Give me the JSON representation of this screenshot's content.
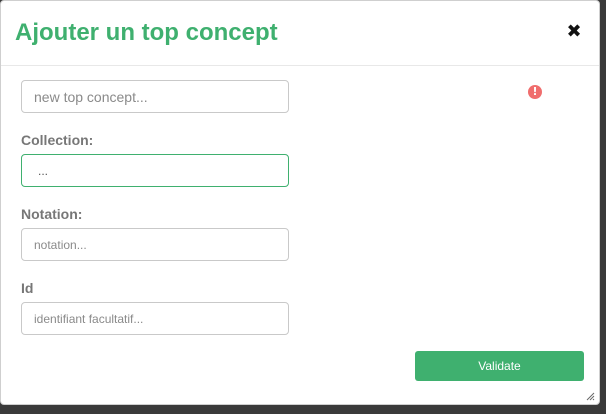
{
  "dialog": {
    "title": "Ajouter un top concept",
    "close_icon": "close-icon"
  },
  "fields": {
    "concept": {
      "placeholder": "new top concept...",
      "value": ""
    },
    "collection": {
      "label": "Collection:",
      "value": "..."
    },
    "notation": {
      "label": "Notation:",
      "placeholder": "notation..."
    },
    "id": {
      "label": "Id",
      "placeholder": "identifiant facultatif..."
    }
  },
  "error_icon": {
    "name": "exclamation-circle-icon",
    "glyph": "!"
  },
  "actions": {
    "validate_label": "Validate"
  },
  "colors": {
    "accent": "#3fb06f",
    "error": "#f06d6d",
    "label": "#777777"
  }
}
